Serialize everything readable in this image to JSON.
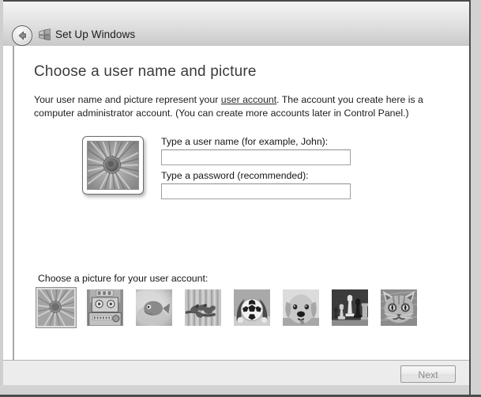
{
  "window": {
    "title": "Set Up Windows",
    "back_icon": "back-arrow-icon",
    "logo_icon": "windows-flag-icon"
  },
  "page": {
    "heading": "Choose a user name and picture",
    "intro_part1": "Your user name and picture represent your ",
    "intro_link": "user account",
    "intro_part2": ". The account you create here is a computer administrator account. (You can create more accounts later in Control Panel.)"
  },
  "form": {
    "username_label": "Type a user name (for example, John):",
    "username_value": "",
    "username_placeholder": "",
    "password_label": "Type a password (recommended):",
    "password_value": "",
    "password_placeholder": ""
  },
  "preview": {
    "picture_name": "flower-picture",
    "alt": "Selected account picture: flower"
  },
  "chooser": {
    "label": "Choose a picture for your user account:",
    "selected_index": 0,
    "pictures": [
      {
        "name": "flower-picture",
        "label": "Flower"
      },
      {
        "name": "robot-picture",
        "label": "Robot"
      },
      {
        "name": "fish-picture",
        "label": "Fish"
      },
      {
        "name": "frog-picture",
        "label": "Frog"
      },
      {
        "name": "soccer-picture",
        "label": "Soccer ball"
      },
      {
        "name": "dog-picture",
        "label": "Dog"
      },
      {
        "name": "chess-picture",
        "label": "Chess"
      },
      {
        "name": "cat-picture",
        "label": "Cat"
      }
    ]
  },
  "footer": {
    "next_label": "Next",
    "next_enabled": false
  },
  "colors": {
    "header_top": "#f4f4f4",
    "header_bottom": "#c9c9c9",
    "content_bg": "#ffffff",
    "footer_bg": "#ececec",
    "heading_text": "#3b3b3b",
    "body_text": "#1c1c1c",
    "disabled_text": "#8d8d8d",
    "border": "#a9a9a9"
  }
}
